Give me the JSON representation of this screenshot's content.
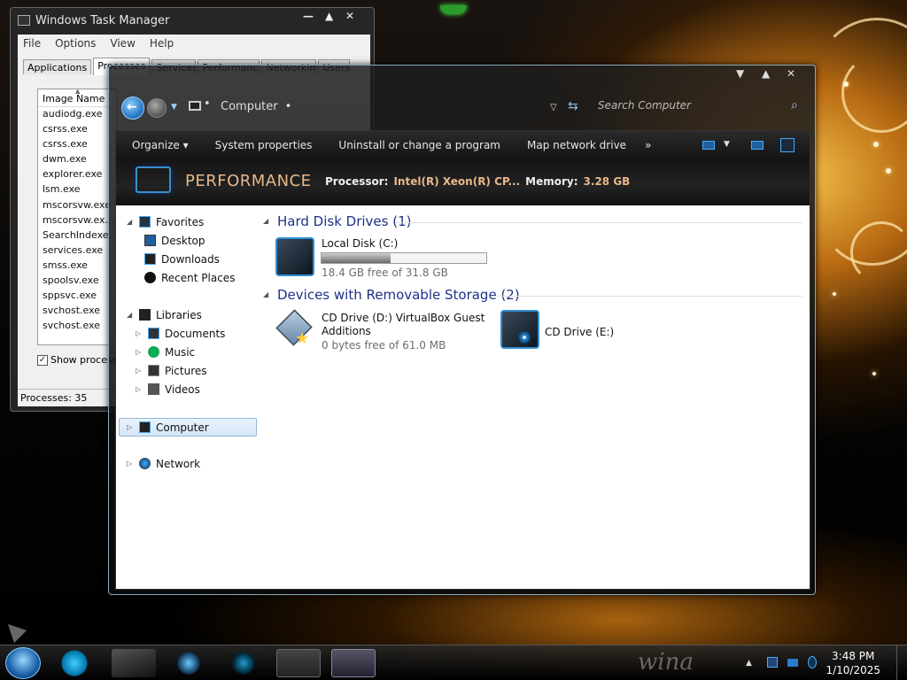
{
  "task_manager": {
    "title": "Windows Task Manager",
    "menu": [
      "File",
      "Options",
      "View",
      "Help"
    ],
    "tabs": [
      "Applications",
      "Processes",
      "Services",
      "Performance",
      "Networking",
      "Users"
    ],
    "column_header": "Image Name",
    "processes": [
      "audiodg.exe",
      "csrss.exe",
      "csrss.exe",
      "dwm.exe",
      "explorer.exe",
      "lsm.exe",
      "mscorsvw.exe",
      "mscorsvw.ex...",
      "SearchIndexe...",
      "services.exe",
      "smss.exe",
      "spoolsv.exe",
      "sppsvc.exe",
      "svchost.exe",
      "svchost.exe"
    ],
    "show_processes_label": "Show processe",
    "status": "Processes: 35"
  },
  "explorer": {
    "address": "Computer",
    "search_placeholder": "Search Computer",
    "commands": [
      "Organize ▾",
      "System properties",
      "Uninstall or change a program",
      "Map network drive",
      "»"
    ],
    "performance": {
      "title": "PERFORMANCE",
      "processor_label": "Processor:",
      "processor_value": "Intel(R) Xeon(R) CP...",
      "memory_label": "Memory:",
      "memory_value": "3.28 GB"
    },
    "nav": {
      "favorites": "Favorites",
      "desktop": "Desktop",
      "downloads": "Downloads",
      "recent": "Recent Places",
      "libraries": "Libraries",
      "documents": "Documents",
      "music": "Music",
      "pictures": "Pictures",
      "videos": "Videos",
      "computer": "Computer",
      "network": "Network"
    },
    "groups": {
      "hdd": "Hard Disk Drives (1)",
      "removable": "Devices with Removable Storage (2)"
    },
    "drives": {
      "c_name": "Local Disk (C:)",
      "c_info": "18.4 GB free of 31.8 GB",
      "c_used_fraction": 0.42,
      "d_name_1": "CD Drive (D:) VirtualBox Guest",
      "d_name_2": "Additions",
      "d_info": "0 bytes free of 61.0 MB",
      "e_name": "CD Drive (E:)"
    }
  },
  "taskbar": {
    "time": "3:48 PM",
    "date": "1/10/2025",
    "watermark": "wina"
  },
  "colors": {
    "group_heading": "#1e3287",
    "performance_accent": "#e9b88a",
    "selection": "#d4e6f8"
  }
}
